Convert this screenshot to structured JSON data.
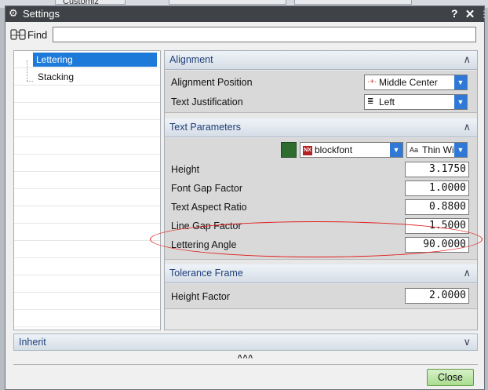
{
  "background": {
    "tab_text": "Customiz"
  },
  "titlebar": {
    "title": "Settings",
    "help": "?",
    "close": "✕",
    "grip": "⋮"
  },
  "find": {
    "label": "Find",
    "value": ""
  },
  "tree": {
    "items": [
      {
        "label": "Lettering",
        "selected": true
      },
      {
        "label": "Stacking",
        "selected": false
      }
    ]
  },
  "groups": {
    "alignment": {
      "title": "Alignment",
      "rows": {
        "position": {
          "label": "Alignment Position",
          "value": "Middle Center"
        },
        "justification": {
          "label": "Text Justification",
          "value": "Left"
        }
      }
    },
    "text_parameters": {
      "title": "Text Parameters",
      "font": "blockfont",
      "font_badge": "NX",
      "style": "Thin Wi",
      "style_prefix": "Aa",
      "color": "#2e6b2e",
      "rows": [
        {
          "label": "Height",
          "value": "3.1750"
        },
        {
          "label": "Font Gap Factor",
          "value": "1.0000"
        },
        {
          "label": "Text Aspect Ratio",
          "value": "0.8800"
        },
        {
          "label": "Line Gap Factor",
          "value": "1.5000"
        },
        {
          "label": "Lettering Angle",
          "value": "90.0000"
        }
      ]
    },
    "tolerance_frame": {
      "title": "Tolerance Frame",
      "rows": [
        {
          "label": "Height Factor",
          "value": "2.0000"
        }
      ]
    }
  },
  "inherit": {
    "title": "Inherit"
  },
  "expander": "^^^",
  "buttons": {
    "close": "Close"
  },
  "colors": {
    "accent": "#1e7ad9",
    "highlight": "#e21b1b",
    "close_button": "#a9dc8f"
  }
}
